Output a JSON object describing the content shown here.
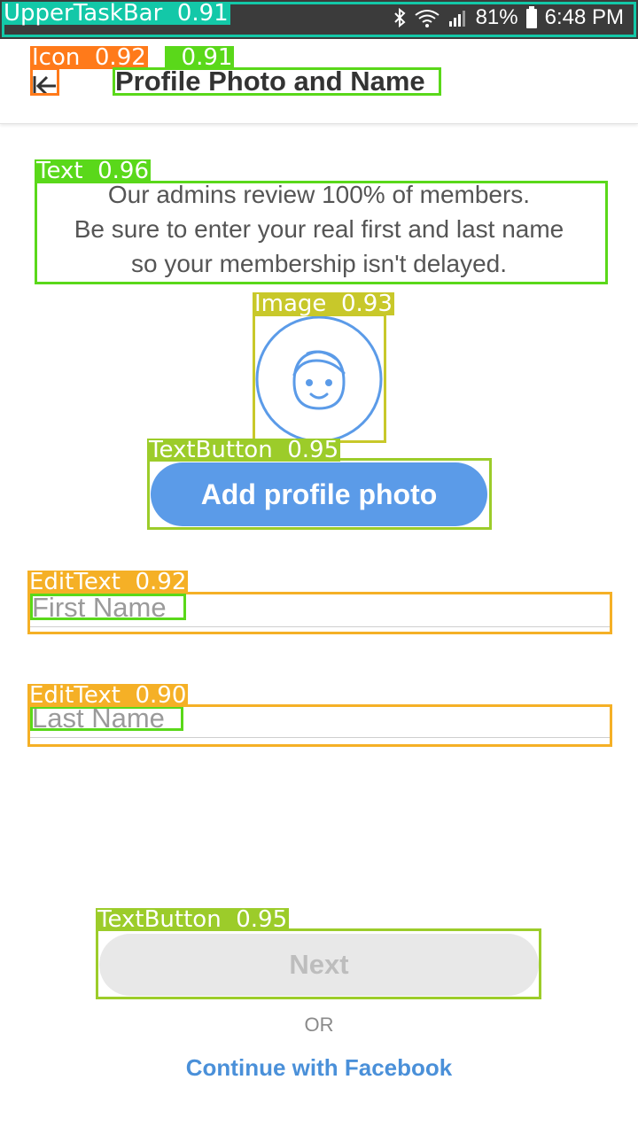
{
  "status_bar": {
    "battery": "81%",
    "time": "6:48 PM"
  },
  "header": {
    "back_icon": "back-arrow-icon",
    "title": "Profile Photo and Name"
  },
  "intro_text": {
    "line1": "Our admins review 100% of members.",
    "line2": "Be sure to enter your real first and last name",
    "line3": "so your membership isn't delayed."
  },
  "avatar": {
    "icon": "smiling-face-avatar-icon",
    "color": "#5b9be8"
  },
  "add_photo_button": {
    "label": "Add profile photo",
    "color": "#5b9be8"
  },
  "form": {
    "first_name": {
      "placeholder": "First Name",
      "value": ""
    },
    "last_name": {
      "placeholder": "Last Name",
      "value": ""
    }
  },
  "next_button": {
    "label": "Next"
  },
  "or_label": "OR",
  "facebook_link": {
    "label": "Continue with Facebook",
    "color": "#4a90d9"
  },
  "detections": [
    {
      "label": "UpperTaskBar",
      "score": "0.91",
      "color": "#13c8a8"
    },
    {
      "label": "Icon",
      "score": "0.92",
      "color": "#ff7a1a"
    },
    {
      "label": "",
      "score": "0.91",
      "color": "#5ad81a"
    },
    {
      "label": "Text",
      "score": "0.96",
      "color": "#5ad81a"
    },
    {
      "label": "Image",
      "score": "0.93",
      "color": "#c8c82a"
    },
    {
      "label": "TextButton",
      "score": "0.95",
      "color": "#9ccc2a"
    },
    {
      "label": "EditText",
      "score": "0.92",
      "color": "#f5b026"
    },
    {
      "label": "EditText",
      "score": "0.90",
      "color": "#f5b026"
    },
    {
      "label": "TextButton",
      "score": "0.95",
      "color": "#9ccc2a"
    }
  ]
}
